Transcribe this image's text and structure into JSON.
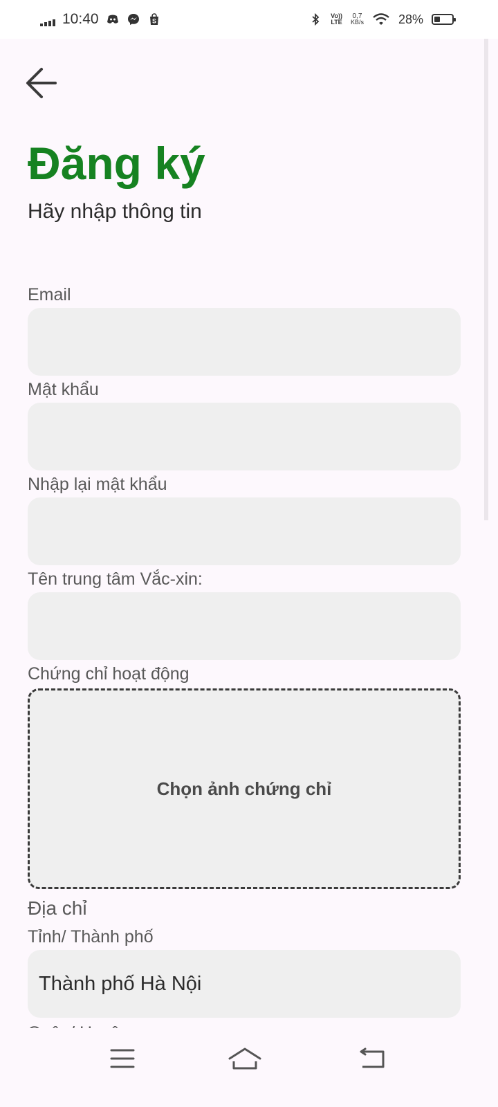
{
  "status_bar": {
    "time": "10:40",
    "net_speed_value": "0,7",
    "net_speed_unit": "KB/s",
    "volte_top": "Vo))",
    "volte_bottom": "LTE",
    "battery_percent": "28%",
    "battery_level": 0.28,
    "icons": [
      "signal-icon",
      "discord-icon",
      "messenger-icon",
      "shopee-icon",
      "bluetooth-icon",
      "volte-icon",
      "wifi-icon",
      "battery-icon"
    ]
  },
  "header": {
    "back_icon": "arrow-left-icon",
    "title": "Đăng ký",
    "subtitle": "Hãy nhập thông tin"
  },
  "form": {
    "email": {
      "label": "Email",
      "value": ""
    },
    "password": {
      "label": "Mật khẩu",
      "value": ""
    },
    "confirm_password": {
      "label": "Nhập lại mật khẩu",
      "value": ""
    },
    "center_name": {
      "label": "Tên trung tâm Vắc-xin:",
      "value": ""
    },
    "certificate": {
      "label": "Chứng chỉ hoạt động",
      "upload_label": "Chọn ảnh chứng chỉ"
    },
    "address_section": "Địa chỉ",
    "province": {
      "label": "Tỉnh/ Thành phố",
      "value": "Thành phố Hà Nội"
    },
    "district_label_partial": "Quận/ Huyện"
  },
  "nav_bar": {
    "icons": [
      "menu-icon",
      "home-icon",
      "back-icon"
    ]
  },
  "colors": {
    "accent": "#168221",
    "field_bg": "#efefef",
    "page_bg": "#fdf8fd"
  }
}
